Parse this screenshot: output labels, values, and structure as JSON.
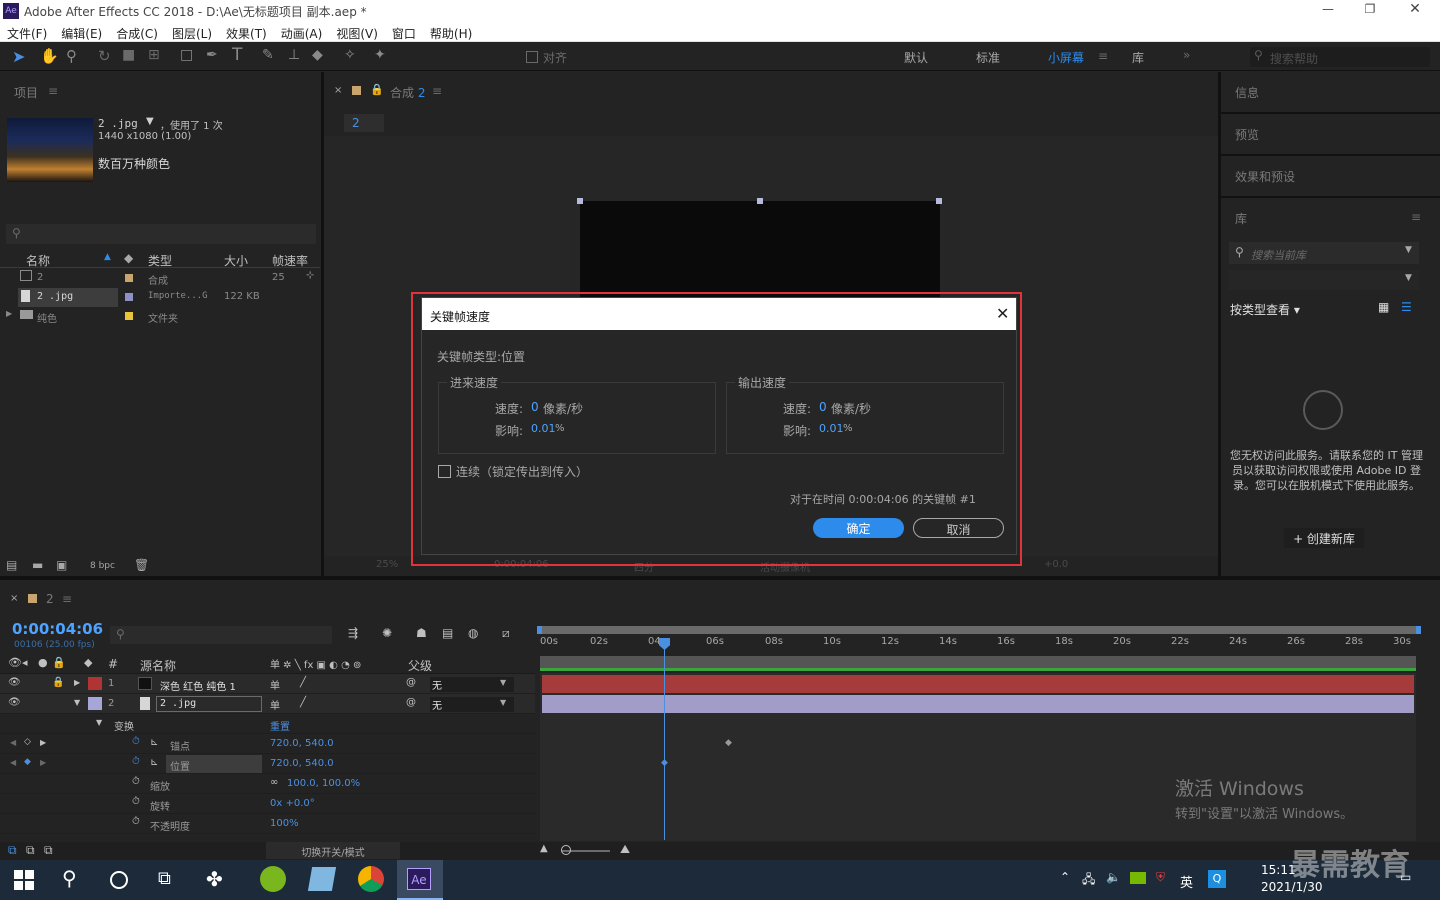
{
  "window": {
    "title": "Adobe After Effects CC 2018 - D:\\Ae\\无标题项目 副本.aep *",
    "app_icon": "Ae",
    "controls": [
      "—",
      "❐",
      "✕"
    ]
  },
  "menu": [
    "文件(F)",
    "编辑(E)",
    "合成(C)",
    "图层(L)",
    "效果(T)",
    "动画(A)",
    "视图(V)",
    "窗口",
    "帮助(H)"
  ],
  "toolbar": {
    "align_label": "对齐",
    "workspaces": [
      "默认",
      "标准",
      "小屏幕",
      "库"
    ],
    "active_workspace": "小屏幕",
    "search_placeholder": "搜索帮助"
  },
  "project": {
    "title": "项目",
    "asset": {
      "name": "2 .jpg",
      "used": "，使用了 1 次",
      "dims": "1440 x1080 (1.00)",
      "colors": "数百万种颜色"
    },
    "columns": [
      "名称",
      "类型",
      "大小",
      "帧速率"
    ],
    "rows": [
      {
        "name": "2",
        "type": "合成",
        "size": "",
        "fps": "25",
        "color": "#c8a46e"
      },
      {
        "name": "2 .jpg",
        "type": "Importe...G",
        "size": "122 KB",
        "fps": "",
        "color": "#9090c8"
      },
      {
        "name": "纯色",
        "type": "文件夹",
        "size": "",
        "fps": "",
        "color": "#e8c53a"
      }
    ],
    "bpc": "8 bpc"
  },
  "comp": {
    "title": "合成",
    "name": "2",
    "tab": "2",
    "zoom": "25%",
    "timecode": "0:00:04:06",
    "quality": "四分",
    "camera": "活动摄像机",
    "offset": "+0.0"
  },
  "right": {
    "panels": [
      "信息",
      "预览",
      "效果和预设",
      "库"
    ],
    "search_placeholder": "搜索当前库",
    "view_by": "按类型查看",
    "message": "您无权访问此服务。请联系您的 IT 管理员以获取访问权限或使用 Adobe ID 登录。您可以在脱机模式下使用此服务。",
    "create_btn": "+ 创建新库"
  },
  "dialog": {
    "title": "关键帧速度",
    "keyframe_type": "关键帧类型:位置",
    "incoming": {
      "label": "进来速度",
      "speed_label": "速度:",
      "speed_value": "0",
      "speed_unit": "像素/秒",
      "influence_label": "影响:",
      "influence_value": "0.01",
      "influence_unit": "%"
    },
    "outgoing": {
      "label": "输出速度",
      "speed_label": "速度:",
      "speed_value": "0",
      "speed_unit": "像素/秒",
      "influence_label": "影响:",
      "influence_value": "0.01",
      "influence_unit": "%"
    },
    "continuous": "连续（锁定传出到传入）",
    "info": "对于在时间 0:00:04:06 的关键帧 #1",
    "ok": "确定",
    "cancel": "取消"
  },
  "timeline": {
    "comp_name": "2",
    "timecode": "0:00:04:06",
    "frames": "00106 (25.00 fps)",
    "col_source": "源名称",
    "col_parent": "父级",
    "ruler": [
      "00s",
      "02s",
      "04s",
      "06s",
      "08s",
      "10s",
      "12s",
      "14s",
      "16s",
      "18s",
      "20s",
      "22s",
      "24s",
      "26s",
      "28s",
      "30s"
    ],
    "layers": [
      {
        "num": "1",
        "name": "深色 红色 纯色 1",
        "parent": "无",
        "color": "#b03434"
      },
      {
        "num": "2",
        "name": "2 .jpg",
        "parent": "无",
        "color": "#a6a6d8"
      }
    ],
    "transform": "变换",
    "reset": "重置",
    "props": [
      {
        "name": "锚点",
        "value": "720.0, 540.0"
      },
      {
        "name": "位置",
        "value": "720.0, 540.0"
      },
      {
        "name": "缩放",
        "value": "100.0, 100.0%"
      },
      {
        "name": "旋转",
        "value": "0x +0.0°"
      },
      {
        "name": "不透明度",
        "value": "100%"
      }
    ],
    "toggle_label": "切换开关/模式"
  },
  "watermark": {
    "line1": "激活 Windows",
    "line2": "转到\"设置\"以激活 Windows。",
    "brand": "暴需教育"
  },
  "taskbar": {
    "time": "15:11",
    "date": "2021/1/30",
    "lang": "英",
    "ae": "Ae"
  }
}
